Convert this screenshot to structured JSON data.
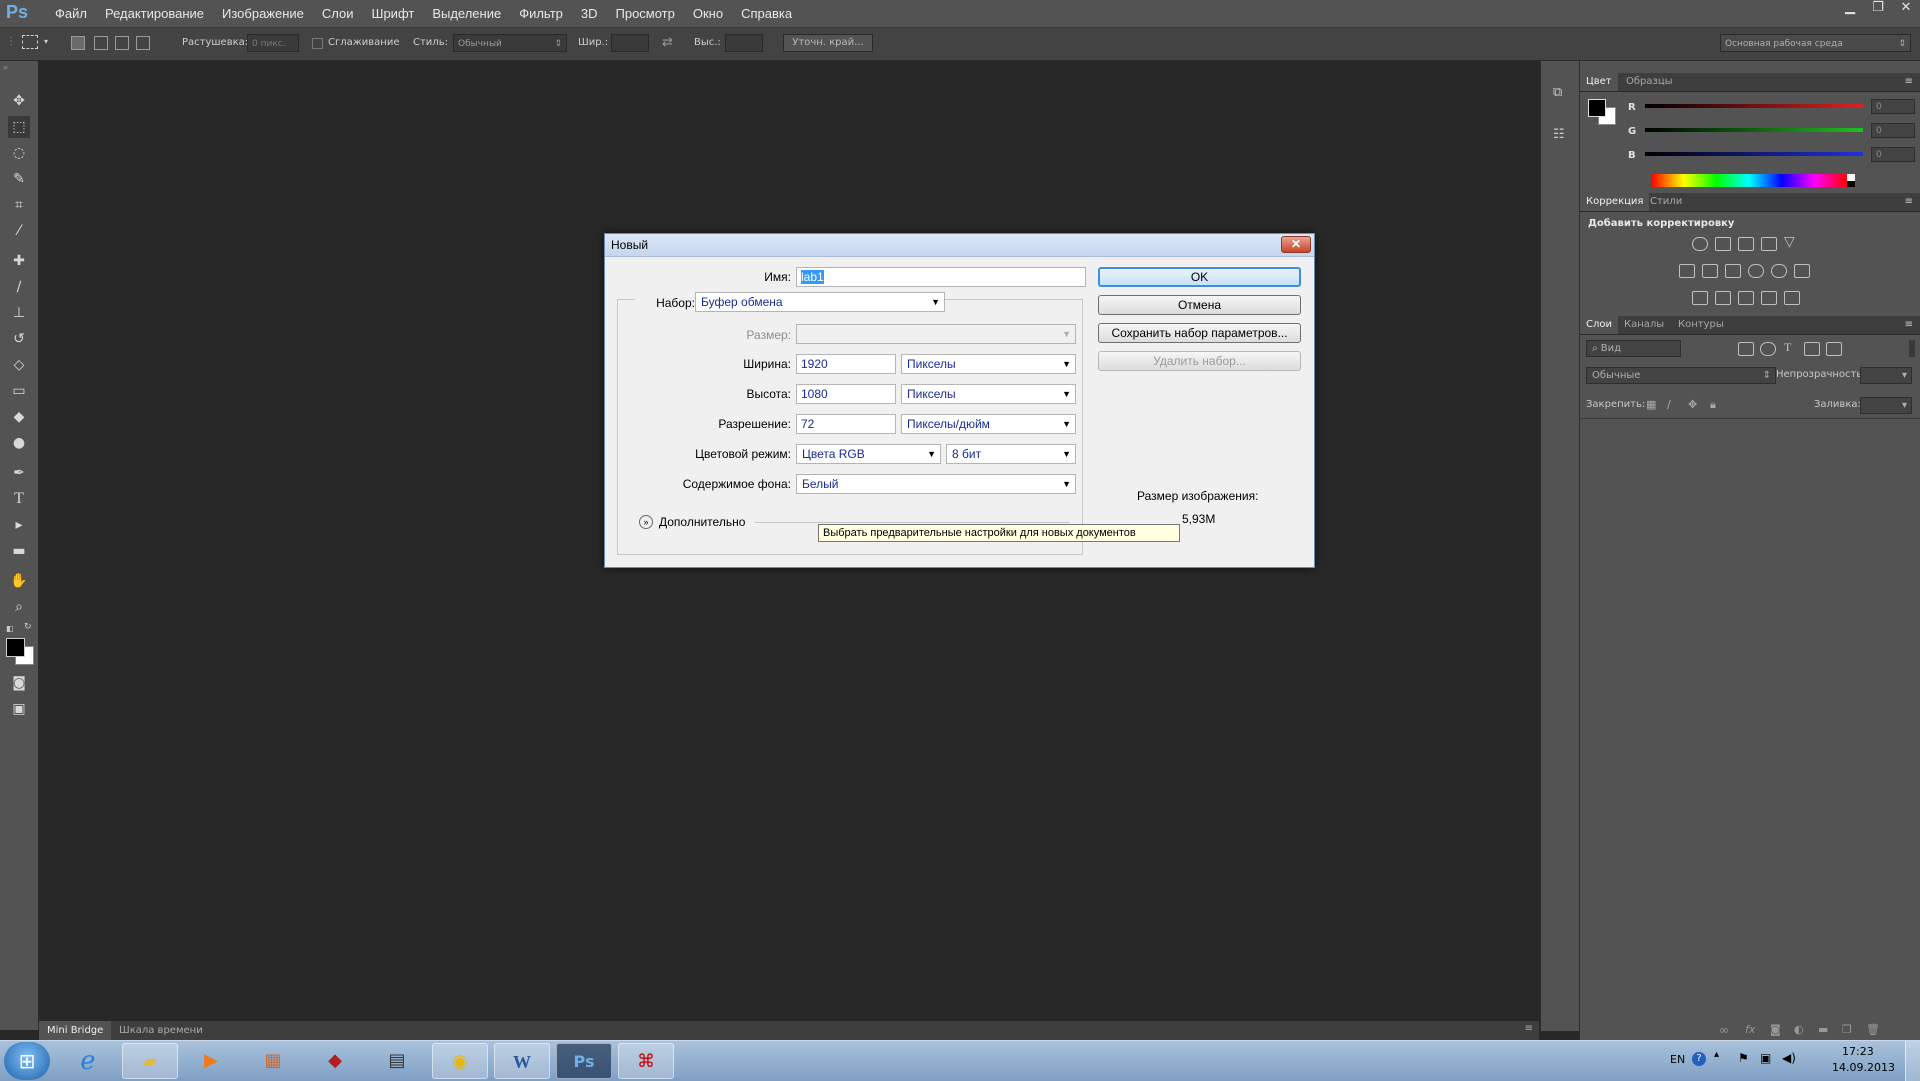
{
  "app": {
    "logo": "Ps"
  },
  "menu": [
    "Файл",
    "Редактирование",
    "Изображение",
    "Слои",
    "Шрифт",
    "Выделение",
    "Фильтр",
    "3D",
    "Просмотр",
    "Окно",
    "Справка"
  ],
  "window_controls": {
    "minimize_icon": "minimize-icon",
    "restore_icon": "restore-icon",
    "close": "✕"
  },
  "options_bar": {
    "feather_label": "Растушевка:",
    "feather_value": "0 пикс.",
    "antialias_label": "Сглаживание",
    "style_label": "Стиль:",
    "style_value": "Обычный",
    "width_label": "Шир.:",
    "height_label": "Выс.:",
    "refine_edge": "Уточн. край...",
    "workspace": "Основная рабочая среда"
  },
  "color_panel": {
    "tabs": [
      "Цвет",
      "Образцы"
    ],
    "channels": [
      {
        "label": "R",
        "value": "0",
        "color": "#e02020"
      },
      {
        "label": "G",
        "value": "0",
        "color": "#20c020"
      },
      {
        "label": "B",
        "value": "0",
        "color": "#2030e0"
      }
    ]
  },
  "adjustments_panel": {
    "tabs": [
      "Коррекция",
      "Стили"
    ],
    "title": "Добавить корректировку"
  },
  "layers_panel": {
    "tabs": [
      "Слои",
      "Каналы",
      "Контуры"
    ],
    "filter_value": "Вид",
    "blend_mode": "Обычные",
    "opacity_label": "Непрозрачность:",
    "lock_label": "Закрепить:",
    "fill_label": "Заливка:"
  },
  "bottom_tabs": [
    "Mini Bridge",
    "Шкала времени"
  ],
  "dialog": {
    "title": "Новый",
    "name_label": "Имя:",
    "name_value": "lab1",
    "preset_label": "Набор:",
    "preset_value": "Буфер обмена",
    "size_label": "Размер:",
    "width_label": "Ширина:",
    "width_value": "1920",
    "width_unit": "Пикселы",
    "height_label": "Высота:",
    "height_value": "1080",
    "height_unit": "Пикселы",
    "resolution_label": "Разрешение:",
    "resolution_value": "72",
    "resolution_unit": "Пикселы/дюйм",
    "color_mode_label": "Цветовой режим:",
    "color_mode_value": "Цвета RGB",
    "bit_depth": "8 бит",
    "background_label": "Содержимое фона:",
    "background_value": "Белый",
    "advanced_label": "Дополнительно",
    "ok": "OK",
    "cancel": "Отмена",
    "save_preset": "Сохранить набор параметров...",
    "delete_preset": "Удалить набор...",
    "image_size_label": "Размер изображения:",
    "image_size_value": "5,93M"
  },
  "tooltip": "Выбрать предварительные настройки для новых документов",
  "taskbar": {
    "lang": "EN",
    "time": "17:23",
    "date": "14.09.2013"
  }
}
